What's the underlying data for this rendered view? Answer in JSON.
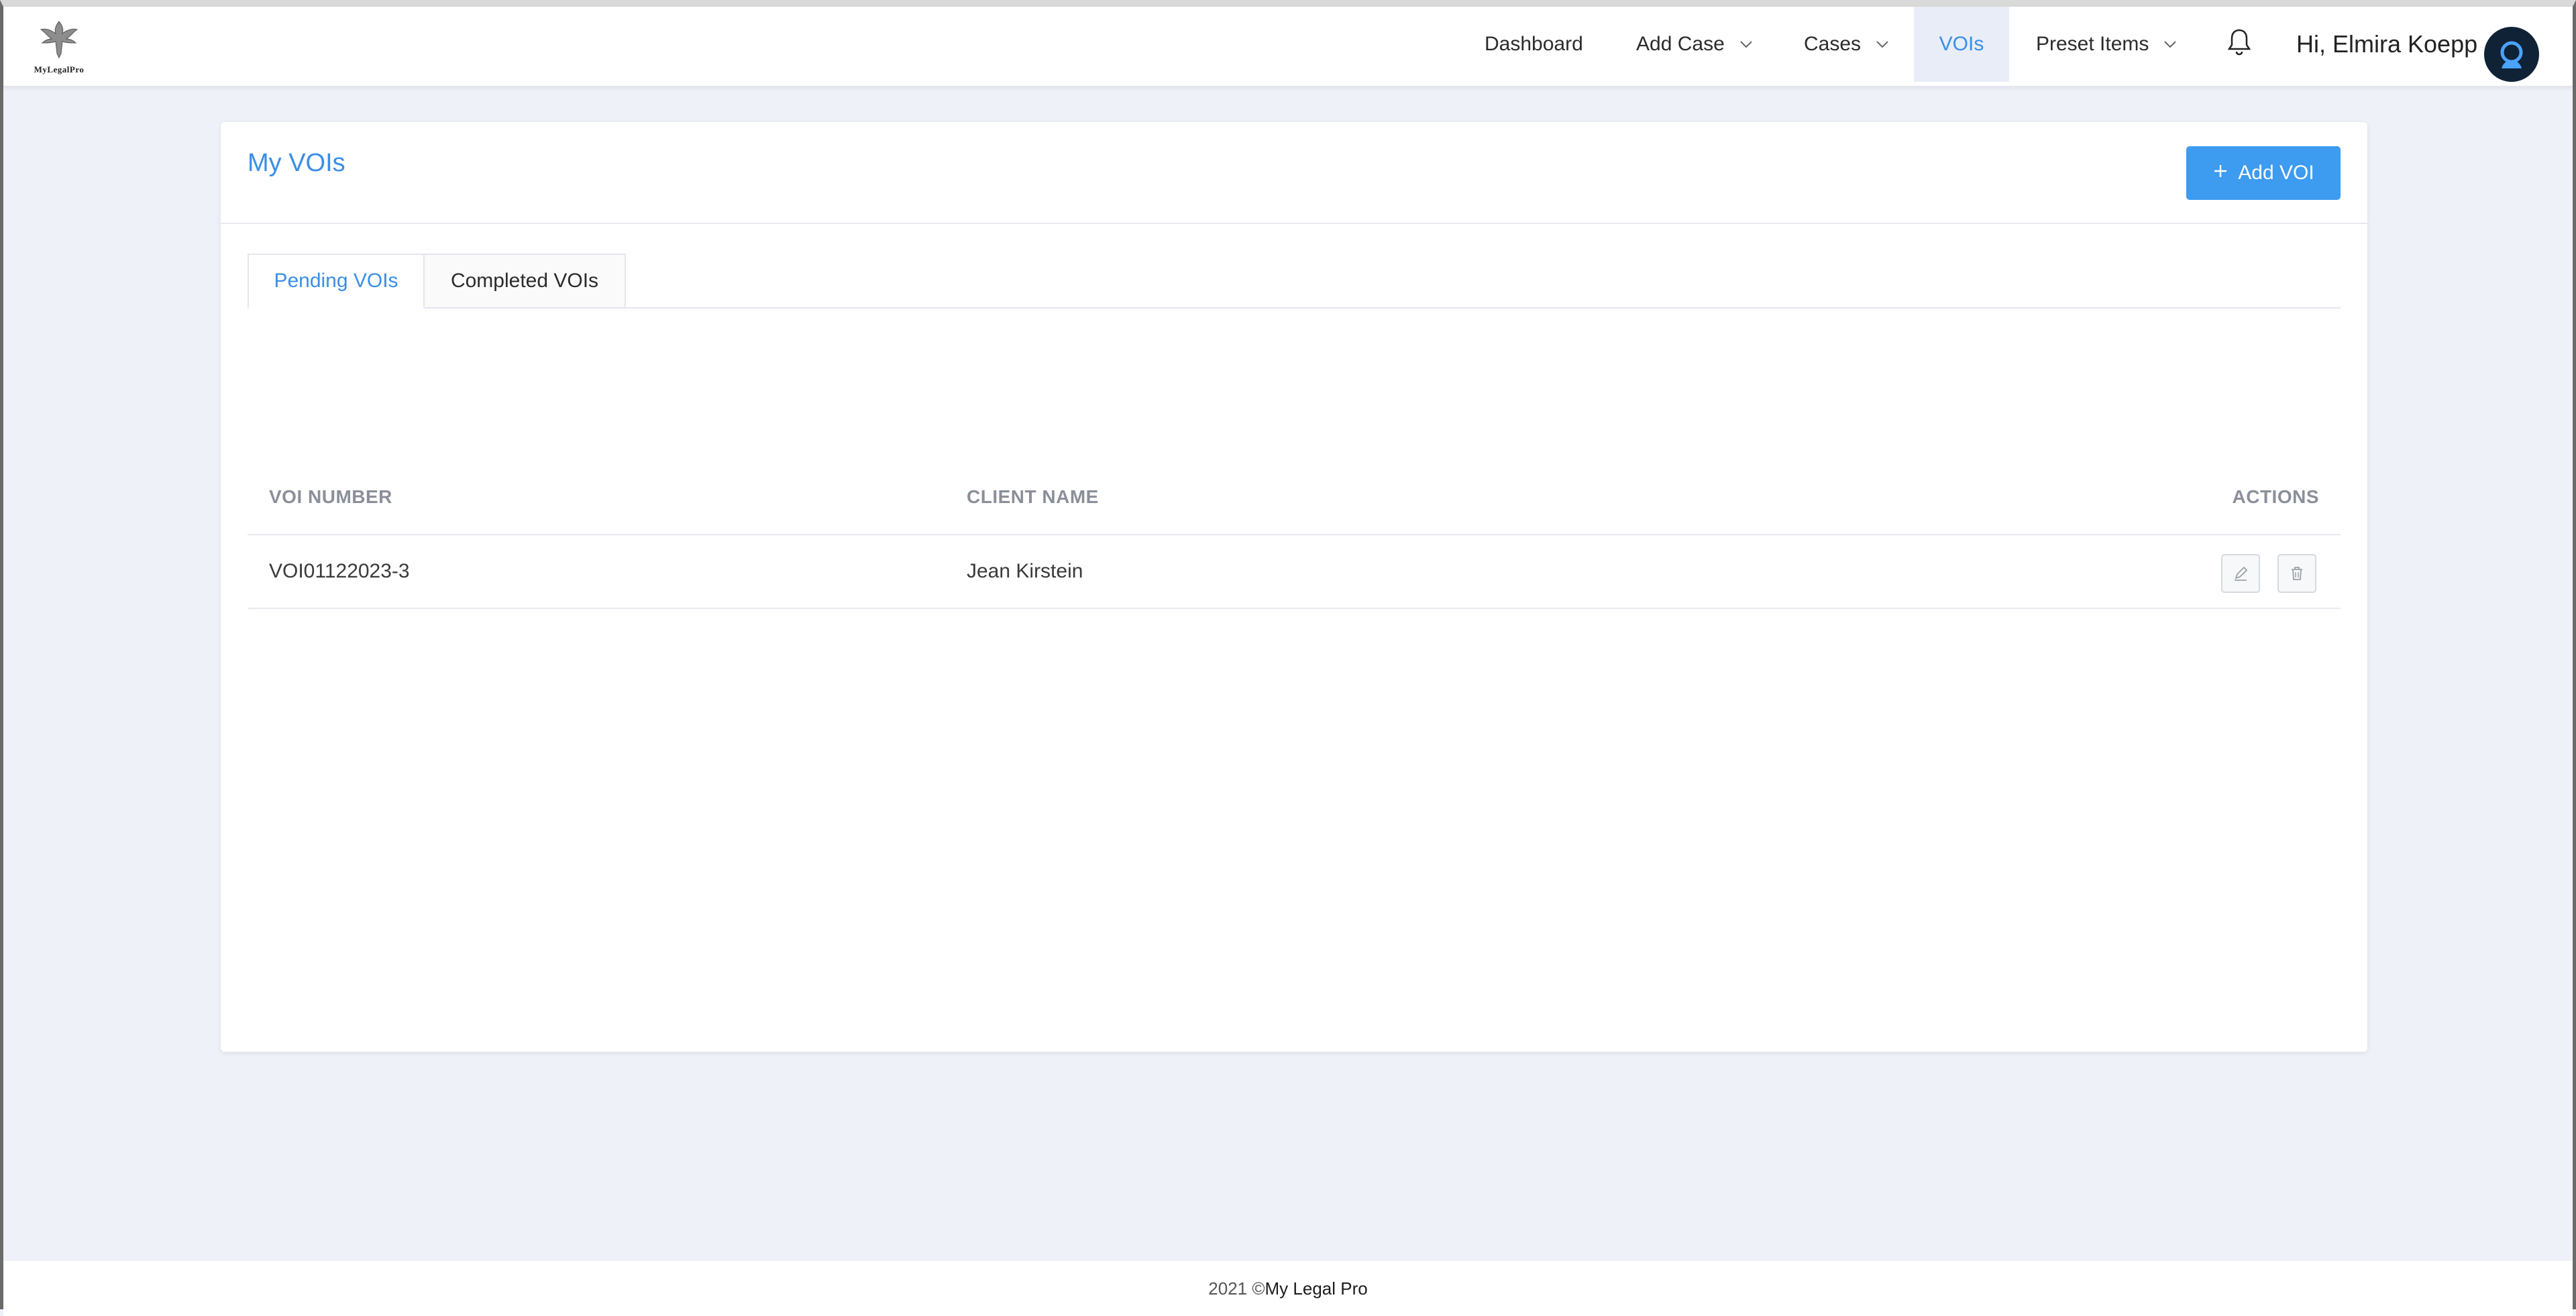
{
  "header": {
    "logo_text": "MyLegalPro",
    "nav": [
      {
        "label": "Dashboard",
        "has_dropdown": false,
        "active": false
      },
      {
        "label": "Add Case",
        "has_dropdown": true,
        "active": false
      },
      {
        "label": "Cases",
        "has_dropdown": true,
        "active": false
      },
      {
        "label": "VOIs",
        "has_dropdown": false,
        "active": true
      },
      {
        "label": "Preset Items",
        "has_dropdown": true,
        "active": false
      }
    ],
    "notification_icon": "bell-icon",
    "greeting": "Hi, Elmira Koepp",
    "avatar_icon": "user-avatar-icon"
  },
  "page": {
    "title": "My VOIs",
    "add_button_label": "Add VOI",
    "tabs": [
      {
        "label": "Pending VOIs",
        "active": true
      },
      {
        "label": "Completed VOIs",
        "active": false
      }
    ],
    "table": {
      "columns": [
        "VOI NUMBER",
        "CLIENT NAME",
        "ACTIONS"
      ],
      "rows": [
        {
          "voi_number": "VOI01122023-3",
          "client_name": "Jean Kirstein"
        }
      ]
    }
  },
  "footer": {
    "copyright": "2021 ©",
    "brand": "My Legal Pro"
  },
  "colors": {
    "accent": "#3a8ee6",
    "button": "#3d9bf0",
    "background": "#eef1f8",
    "avatar": "#0f2236"
  }
}
